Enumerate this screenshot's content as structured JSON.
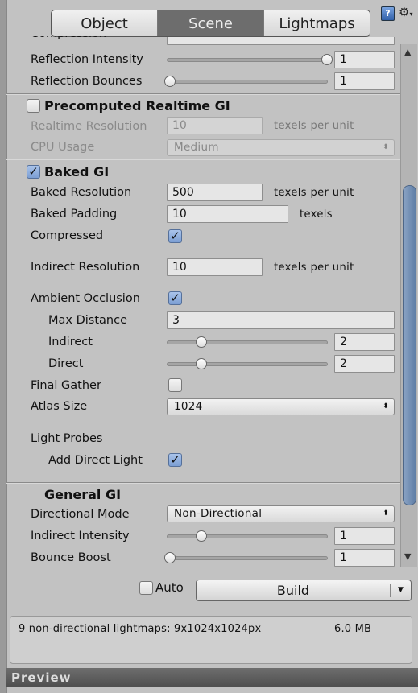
{
  "tabs": [
    {
      "label": "Object",
      "active": false
    },
    {
      "label": "Scene",
      "active": true
    },
    {
      "label": "Lightmaps",
      "active": false
    }
  ],
  "header_icons": [
    "help-icon",
    "gear-menu-icon"
  ],
  "cut_off_label": "Compression",
  "environment": {
    "reflection_intensity": {
      "label": "Reflection Intensity",
      "value": "1",
      "min": 0,
      "max": 1
    },
    "reflection_bounces": {
      "label": "Reflection Bounces",
      "value": "1",
      "min": 1,
      "max": 5
    }
  },
  "realtime_gi": {
    "title": "Precomputed Realtime GI",
    "enabled": false,
    "resolution_label": "Realtime Resolution",
    "resolution_value": "10",
    "resolution_unit": "texels per unit",
    "cpu_label": "CPU Usage",
    "cpu_value": "Medium"
  },
  "baked_gi": {
    "title": "Baked GI",
    "enabled": true,
    "resolution_label": "Baked Resolution",
    "resolution_value": "500",
    "resolution_unit": "texels per unit",
    "padding_label": "Baked Padding",
    "padding_value": "10",
    "padding_unit": "texels",
    "compressed_label": "Compressed",
    "compressed": true,
    "indirect_resolution_label": "Indirect Resolution",
    "indirect_resolution_value": "10",
    "indirect_resolution_unit": "texels per unit",
    "ao_label": "Ambient Occlusion",
    "ao": true,
    "max_distance_label": "Max Distance",
    "max_distance_value": "3",
    "indirect": {
      "label": "Indirect",
      "value": "2",
      "min": 0,
      "max": 10
    },
    "direct": {
      "label": "Direct",
      "value": "2",
      "min": 0,
      "max": 10
    },
    "final_gather_label": "Final Gather",
    "final_gather": false,
    "atlas_label": "Atlas Size",
    "atlas_value": "1024",
    "light_probes_label": "Light Probes",
    "add_direct_light_label": "Add Direct Light",
    "add_direct_light": true
  },
  "general_gi": {
    "title": "General GI",
    "directional_label": "Directional Mode",
    "directional_value": "Non-Directional",
    "indirect_intensity": {
      "label": "Indirect Intensity",
      "value": "1",
      "min": 0,
      "max": 5
    },
    "bounce_boost": {
      "label": "Bounce Boost",
      "value": "1",
      "min": 1,
      "max": 10
    }
  },
  "footer": {
    "auto_label": "Auto",
    "auto": false,
    "build_label": "Build",
    "info_text": "9 non-directional lightmaps: 9x1024x1024px",
    "info_size": "6.0 MB",
    "preview_label": "Preview"
  },
  "colors": {
    "accent_check": "#7b9ed3",
    "scroll_thumb": "#6b88ae",
    "panel_bg": "#c2c2c2"
  }
}
